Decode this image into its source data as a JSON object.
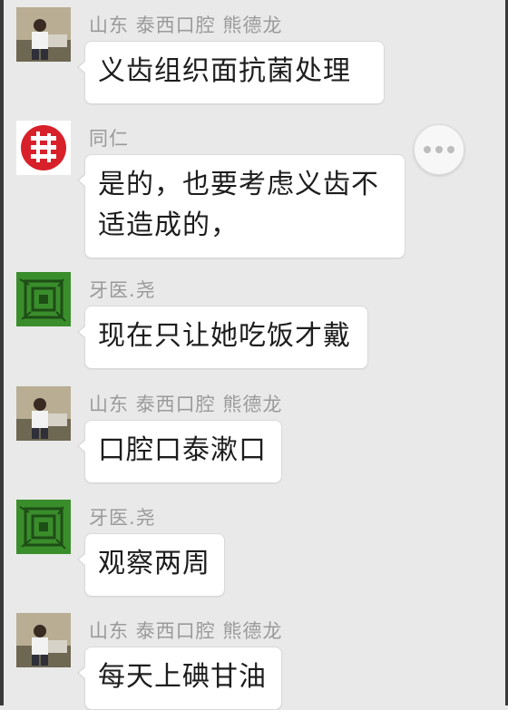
{
  "messages": [
    {
      "sender": "山东  泰西口腔  熊德龙",
      "text": "义齿组织面抗菌处理",
      "avatar": "photo-avatar"
    },
    {
      "sender": "同仁",
      "text": "是的，也要考虑义齿不\n适造成的，",
      "avatar": "red-fu-character-avatar"
    },
    {
      "sender": "牙医.尧",
      "text": "现在只让她吃饭才戴",
      "avatar": "green-pattern-avatar"
    },
    {
      "sender": "山东  泰西口腔  熊德龙",
      "text": "口腔口泰漱口",
      "avatar": "photo-avatar"
    },
    {
      "sender": "牙医.尧",
      "text": "观察两周",
      "avatar": "green-pattern-avatar"
    },
    {
      "sender": "山东  泰西口腔  熊德龙",
      "text": "每天上碘甘油",
      "avatar": "photo-avatar"
    }
  ],
  "more_button": {
    "icon": "ellipsis-icon"
  }
}
